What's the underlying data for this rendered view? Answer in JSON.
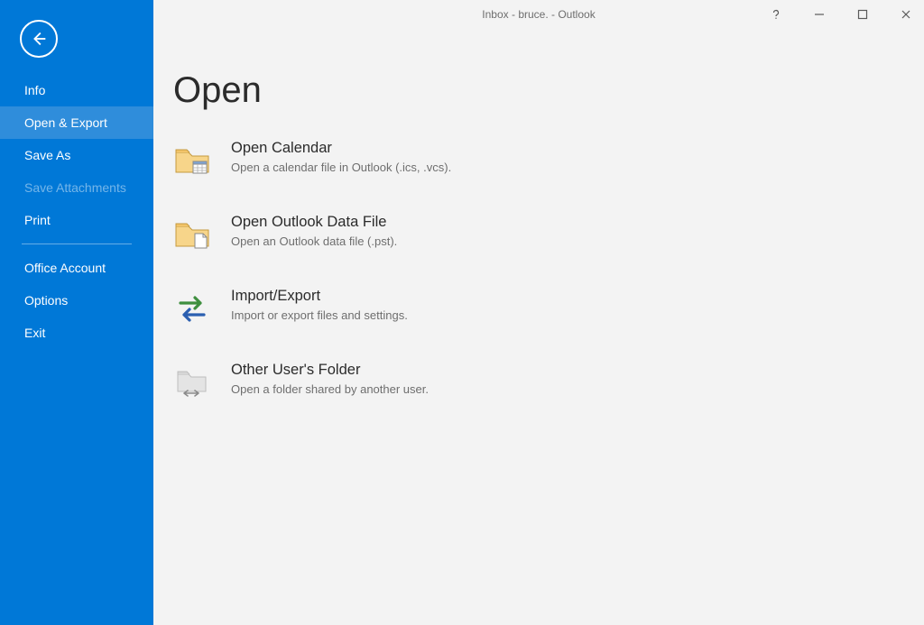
{
  "window": {
    "title": "Inbox - bruce.                           - Outlook"
  },
  "sidebar": {
    "items": [
      {
        "label": "Info",
        "selected": false,
        "disabled": false
      },
      {
        "label": "Open & Export",
        "selected": true,
        "disabled": false
      },
      {
        "label": "Save As",
        "selected": false,
        "disabled": false
      },
      {
        "label": "Save Attachments",
        "selected": false,
        "disabled": true
      },
      {
        "label": "Print",
        "selected": false,
        "disabled": false
      }
    ],
    "bottom": [
      {
        "label": "Office Account"
      },
      {
        "label": "Options"
      },
      {
        "label": "Exit"
      }
    ]
  },
  "page": {
    "title": "Open",
    "commands": [
      {
        "title": "Open Calendar",
        "desc": "Open a calendar file in Outlook (.ics, .vcs)."
      },
      {
        "title": "Open Outlook Data File",
        "desc": "Open an Outlook data file (.pst)."
      },
      {
        "title": "Import/Export",
        "desc": "Import or export files and settings."
      },
      {
        "title": "Other User's Folder",
        "desc": "Open a folder shared by another user."
      }
    ]
  }
}
